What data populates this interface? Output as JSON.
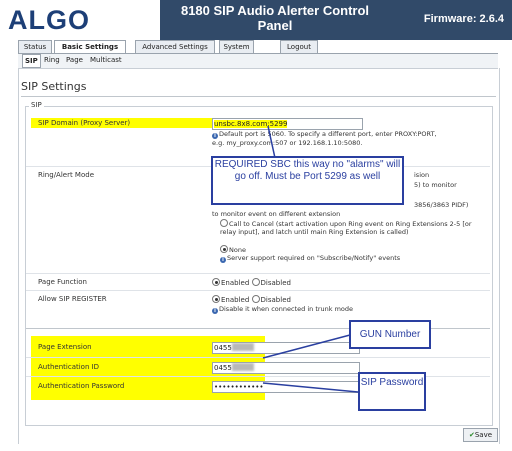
{
  "header": {
    "logo": "ALGO",
    "title_line1": "8180 SIP Audio Alerter Control",
    "title_line2": "Panel",
    "firmware": "Firmware: 2.6.4"
  },
  "tabs": [
    {
      "label": "Status"
    },
    {
      "label": "Basic Settings"
    },
    {
      "label": "Advanced Settings"
    },
    {
      "label": "System"
    },
    {
      "label": "Logout"
    }
  ],
  "subtabs": [
    {
      "label": "SIP"
    },
    {
      "label": "Ring"
    },
    {
      "label": "Page"
    },
    {
      "label": "Multicast"
    }
  ],
  "page_title": "SIP Settings",
  "fieldset_legend": "SIP",
  "sip_domain": {
    "label": "SIP Domain (Proxy Server)",
    "value": "unsbc.8x8.com:5299",
    "hint_line1": "Default port is 5060. To specify a different port, enter PROXY:PORT,",
    "hint_line2": "e.g. my_proxy.com:507   or 192.168.1.10:5080."
  },
  "ring_alert": {
    "label": "Ring/Alert Mode",
    "frag1": "ision",
    "frag2": "5) to monitor",
    "frag3": "3856/3863 PIDF)",
    "frag4": "to monitor event on different extension",
    "option_call_to_cancel": "Call to Cancel (start activation upon Ring event on Ring Extensions 2-5 [or relay input], and latch until main Ring Extension is called)",
    "option_none": "None",
    "hint": "Server support required on \"Subscribe/Notify\" events"
  },
  "page_function": {
    "label": "Page Function",
    "enabled": "Enabled",
    "disabled": "Disabled"
  },
  "allow_register": {
    "label": "Allow SIP REGISTER",
    "enabled": "Enabled",
    "disabled": "Disabled",
    "hint": "Disable it when connected in trunk mode"
  },
  "page_extension": {
    "label": "Page Extension",
    "value": "0455"
  },
  "auth_id": {
    "label": "Authentication ID",
    "value": "0455"
  },
  "auth_password": {
    "label": "Authentication Password",
    "value": "••••••••••••"
  },
  "callouts": {
    "required": "REQUIRED SBC this way no \"alarms\" will go off. Must be Port 5299 as well",
    "gun": "GUN Number",
    "sip_password": "SIP Password"
  },
  "save_label": "Save",
  "colors": {
    "highlight": "#ffff00",
    "callout_border": "#2a3fa0",
    "titlebar": "#314a69",
    "logo": "#1d3f77"
  }
}
